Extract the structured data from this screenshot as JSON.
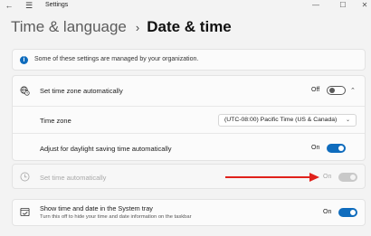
{
  "window": {
    "title": "Settings",
    "back_glyph": "←",
    "menu_glyph": "☰",
    "minimize_glyph": "—",
    "maximize_glyph": "☐",
    "close_glyph": "✕"
  },
  "breadcrumb": {
    "parent": "Time & language",
    "separator": "›",
    "current": "Date & time"
  },
  "notice": {
    "icon": "info-icon",
    "icon_glyph": "i",
    "text": "Some of these settings are managed by your organization."
  },
  "settings": {
    "set_time_zone_auto": {
      "label": "Set time zone automatically",
      "state": "Off",
      "toggle_on": false,
      "expanded": true,
      "chevron_glyph": "⌃",
      "icon": "globe-clock-icon"
    },
    "time_zone": {
      "label": "Time zone",
      "value": "(UTC-08:00) Pacific Time (US & Canada)",
      "chevron_glyph": "⌄"
    },
    "daylight_saving": {
      "label": "Adjust for daylight saving time automatically",
      "state": "On",
      "toggle_on": true
    },
    "set_time_auto": {
      "label": "Set time automatically",
      "state": "On",
      "toggle_on": true,
      "disabled": true,
      "icon": "clock-icon"
    },
    "system_tray": {
      "label": "Show time and date in the System tray",
      "description": "Turn this off to hide your time and date information on the taskbar",
      "state": "On",
      "toggle_on": true,
      "icon": "tray-calendar-icon"
    }
  },
  "annotation": {
    "arrow_color": "#e0211b",
    "points_to": "set_time_auto toggle"
  },
  "colors": {
    "accent": "#0f6cbd",
    "background": "#f3f3f3",
    "card": "#fbfbfb"
  }
}
